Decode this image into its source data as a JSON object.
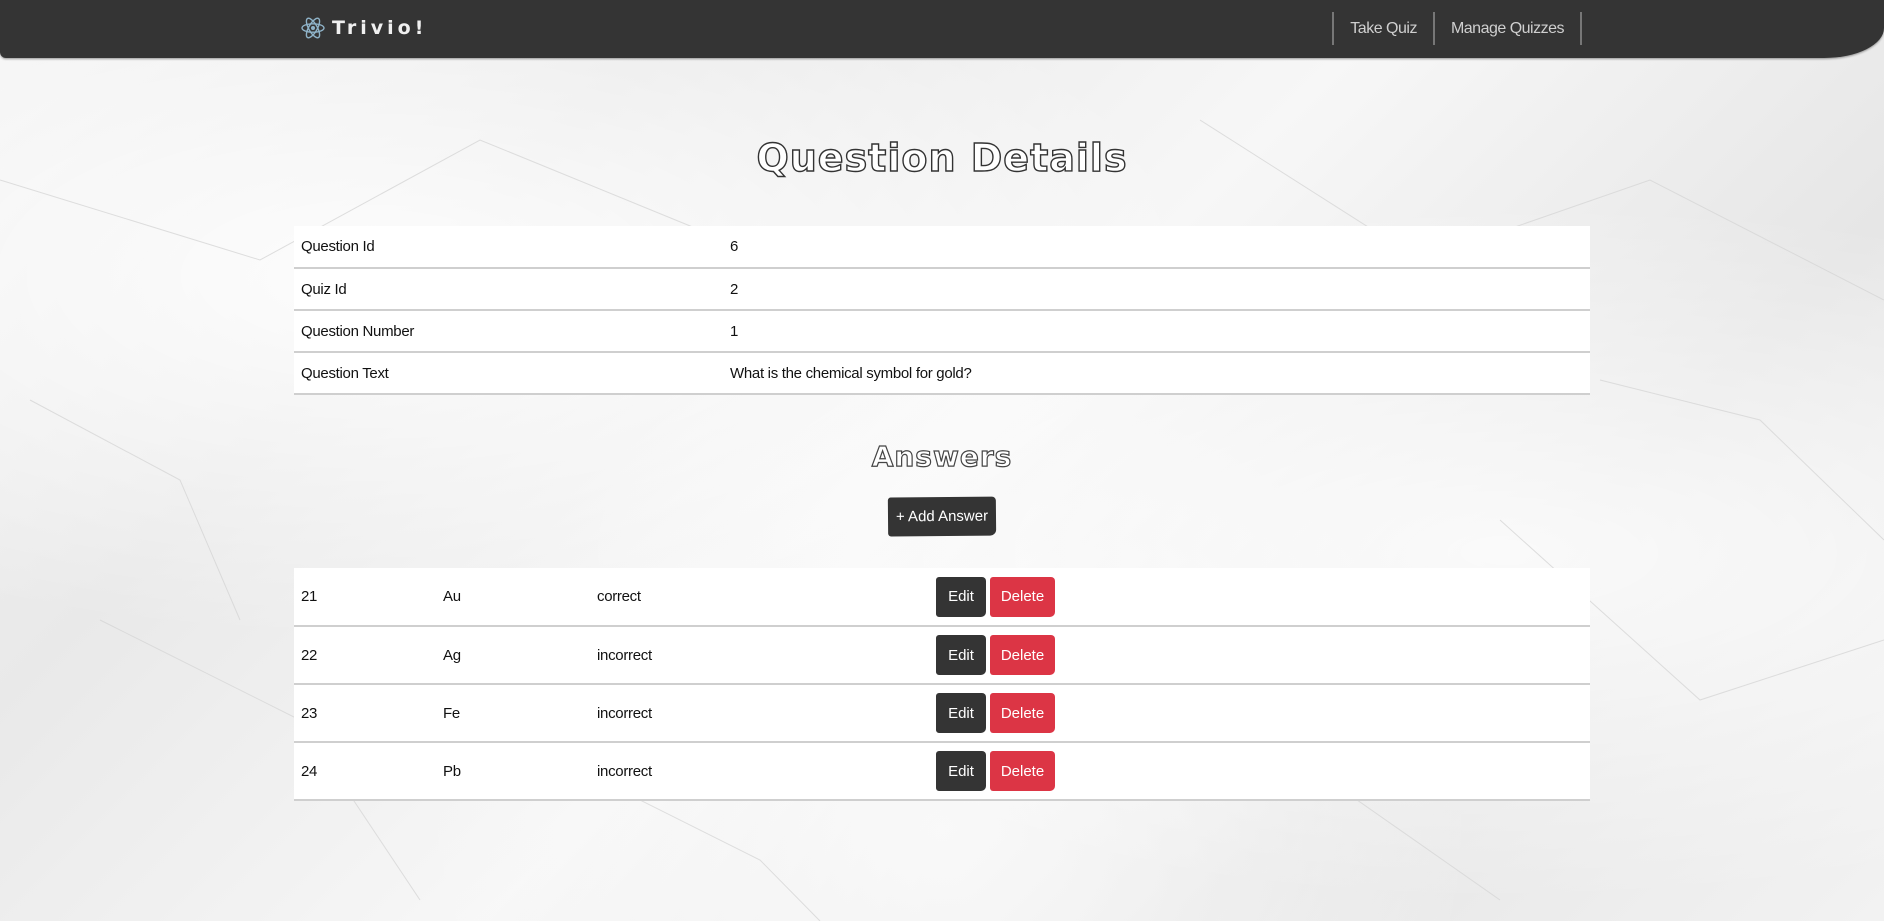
{
  "navbar": {
    "brand": "Trivio!",
    "brand_icon": "atom-icon",
    "links": [
      "Take Quiz",
      "Manage Quizzes"
    ]
  },
  "page_title": "Question Details",
  "details": [
    {
      "label": "Question Id",
      "value": "6"
    },
    {
      "label": "Quiz Id",
      "value": "2"
    },
    {
      "label": "Question Number",
      "value": "1"
    },
    {
      "label": "Question Text",
      "value": "What is the chemical symbol for gold?"
    }
  ],
  "answers_title": "Answers",
  "add_answer_label": "+ Add Answer",
  "answers": [
    {
      "id": "21",
      "text": "Au",
      "status": "correct",
      "edit": "Edit",
      "delete": "Delete"
    },
    {
      "id": "22",
      "text": "Ag",
      "status": "incorrect",
      "edit": "Edit",
      "delete": "Delete"
    },
    {
      "id": "23",
      "text": "Fe",
      "status": "incorrect",
      "edit": "Edit",
      "delete": "Delete"
    },
    {
      "id": "24",
      "text": "Pb",
      "status": "incorrect",
      "edit": "Edit",
      "delete": "Delete"
    }
  ],
  "colors": {
    "navbar": "#343434",
    "dark_button": "#343434",
    "delete_button": "#dc3545"
  }
}
